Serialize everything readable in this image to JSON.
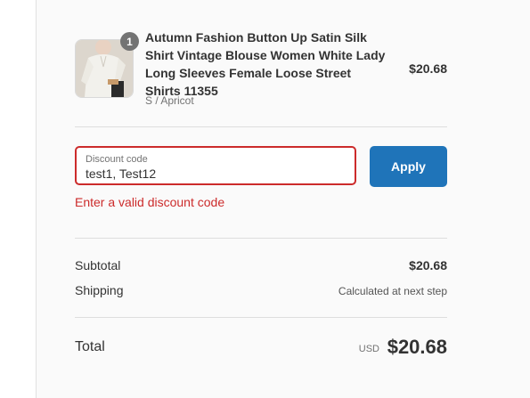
{
  "product": {
    "quantity": "1",
    "name": "Autumn Fashion Button Up Satin Silk Shirt Vintage Blouse Women White Lady Long Sleeves Female Loose Street Shirts 11355",
    "variant": "S / Apricot",
    "price": "$20.68"
  },
  "discount": {
    "label": "Discount code",
    "value": "test1, Test12",
    "apply_label": "Apply",
    "error": "Enter a valid discount code"
  },
  "summary": {
    "subtotal_label": "Subtotal",
    "subtotal_value": "$20.68",
    "shipping_label": "Shipping",
    "shipping_value": "Calculated at next step",
    "total_label": "Total",
    "total_currency": "USD",
    "total_value": "$20.68"
  },
  "colors": {
    "accent": "#1f74b9",
    "error": "#cc2b2b"
  }
}
